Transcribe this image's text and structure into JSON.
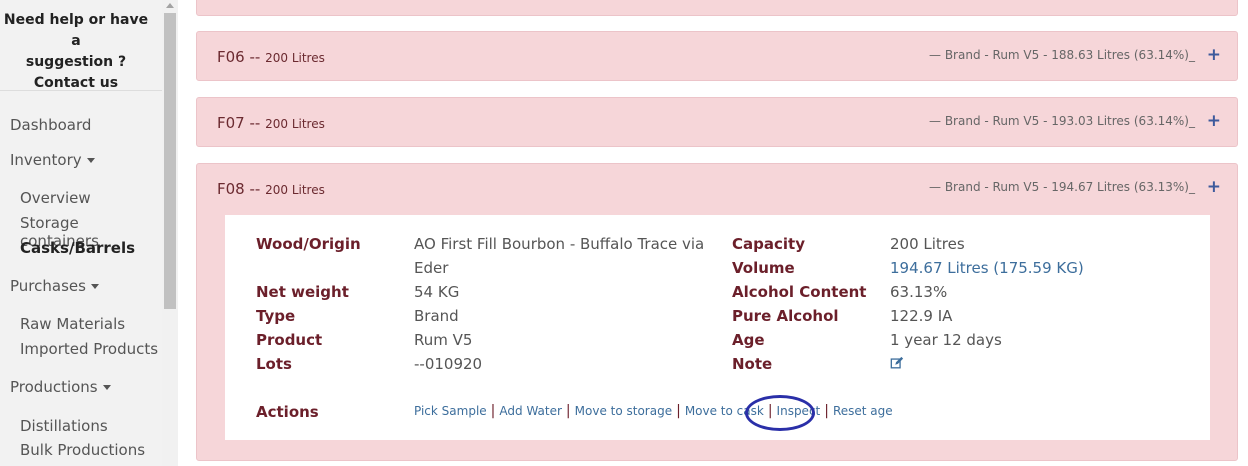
{
  "sidebar": {
    "help_line1": "Need help or have a",
    "help_line2": "suggestion ?",
    "contact": "Contact us",
    "dashboard": "Dashboard",
    "inventory": "Inventory",
    "inventory_items": [
      "Overview",
      "Storage containers",
      "Casks/Barrels"
    ],
    "purchases": "Purchases",
    "purchases_items": [
      "Raw Materials",
      "Imported Products"
    ],
    "productions": "Productions",
    "productions_items": [
      "Distillations",
      "Bulk Productions"
    ]
  },
  "panels": [
    {
      "id": "F06",
      "sep": " -- ",
      "capacity": "200 Litres",
      "summary": "—   Brand - Rum V5 - 188.63 Litres (63.14%)_"
    },
    {
      "id": "F07",
      "sep": " -- ",
      "capacity": "200 Litres",
      "summary": "—   Brand - Rum V5 - 193.03 Litres (63.14%)_"
    },
    {
      "id": "F08",
      "sep": " -- ",
      "capacity": "200 Litres",
      "summary": "—   Brand - Rum V5 - 194.67 Litres (63.13%)_"
    }
  ],
  "plus_symbol": "+",
  "details": {
    "wood_label": "Wood/Origin",
    "wood_value_1": "AO First Fill Bourbon - Buffalo Trace via",
    "wood_value_2": "Eder",
    "net_weight_label": "Net weight",
    "net_weight_value": "54 KG",
    "type_label": "Type",
    "type_value": "Brand",
    "product_label": "Product",
    "product_value": "Rum V5",
    "lots_label": "Lots",
    "lots_value": "--010920",
    "capacity_label": "Capacity",
    "capacity_value": "200 Litres",
    "volume_label": "Volume",
    "volume_value": "194.67 Litres (175.59 KG)",
    "alcohol_label": "Alcohol Content",
    "alcohol_value": "63.13%",
    "pure_label": "Pure Alcohol",
    "pure_value": "122.9 IA",
    "age_label": "Age",
    "age_value": "1 year 12 days",
    "note_label": "Note",
    "note_icon": "edit-icon",
    "actions_label": "Actions",
    "actions": [
      "Pick Sample",
      "Add Water",
      "Move to storage",
      "Move to cask",
      "Inspect",
      "Reset age"
    ]
  },
  "colors": {
    "panel_bg": "#f6d6d9",
    "label": "#6b1f2a",
    "link": "#3d6e9c",
    "highlight": "#2a2fa8"
  }
}
